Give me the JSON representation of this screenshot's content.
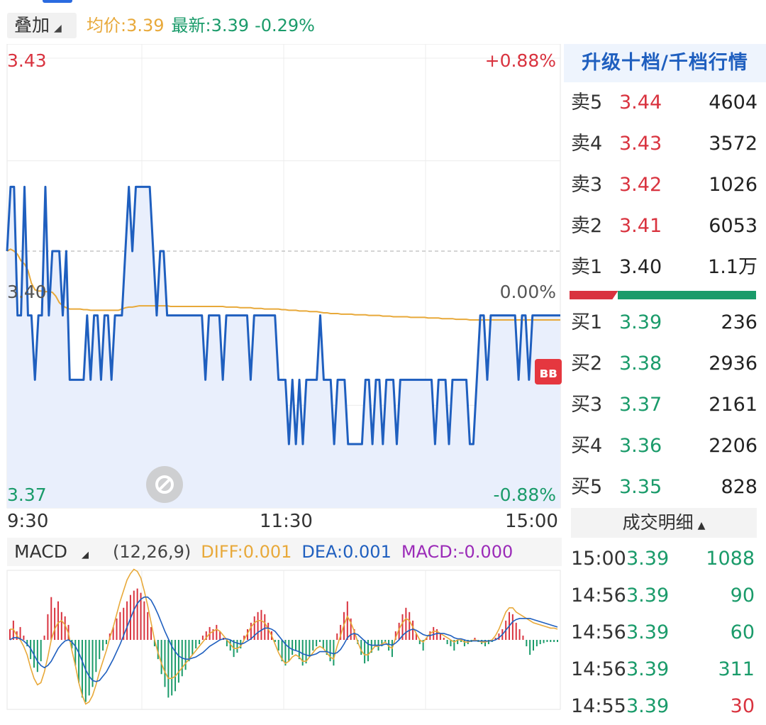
{
  "header": {
    "overlay_label": "叠加",
    "avg_price": "均价:3.39",
    "latest_price": "最新:3.39",
    "change_pct": "-0.29%"
  },
  "chart_data": [
    {
      "type": "line",
      "name": "intraday",
      "price_high_label": "3.43",
      "price_mid_label": "3.40",
      "price_low_label": "3.37",
      "pct_high_label": "+0.88%",
      "pct_mid_label": "0.00%",
      "pct_low_label": "-0.88%",
      "x_ticks": [
        "9:30",
        "11:30",
        "15:00"
      ],
      "ylim": [
        3.37,
        3.43
      ],
      "prev_close": 3.4,
      "price": [
        3.4,
        3.41,
        3.41,
        3.39,
        3.39,
        3.41,
        3.39,
        3.39,
        3.38,
        3.39,
        3.39,
        3.41,
        3.39,
        3.4,
        3.4,
        3.4,
        3.39,
        3.4,
        3.38,
        3.38,
        3.38,
        3.38,
        3.38,
        3.39,
        3.38,
        3.39,
        3.39,
        3.38,
        3.39,
        3.39,
        3.38,
        3.39,
        3.39,
        3.39,
        3.4,
        3.41,
        3.4,
        3.41,
        3.41,
        3.41,
        3.41,
        3.41,
        3.4,
        3.39,
        3.4,
        3.4,
        3.39,
        3.39,
        3.39,
        3.39,
        3.39,
        3.39,
        3.39,
        3.39,
        3.39,
        3.39,
        3.39,
        3.38,
        3.39,
        3.39,
        3.39,
        3.39,
        3.38,
        3.39,
        3.39,
        3.39,
        3.39,
        3.39,
        3.39,
        3.39,
        3.38,
        3.39,
        3.39,
        3.39,
        3.39,
        3.39,
        3.39,
        3.39,
        3.38,
        3.38,
        3.38,
        3.37,
        3.38,
        3.37,
        3.38,
        3.37,
        3.38,
        3.38,
        3.38,
        3.38,
        3.39,
        3.38,
        3.38,
        3.38,
        3.37,
        3.38,
        3.38,
        3.38,
        3.37,
        3.37,
        3.37,
        3.37,
        3.37,
        3.38,
        3.38,
        3.37,
        3.38,
        3.38,
        3.37,
        3.38,
        3.38,
        3.38,
        3.37,
        3.38,
        3.38,
        3.38,
        3.38,
        3.38,
        3.38,
        3.38,
        3.38,
        3.38,
        3.38,
        3.37,
        3.38,
        3.38,
        3.38,
        3.37,
        3.38,
        3.38,
        3.38,
        3.38,
        3.38,
        3.37,
        3.37,
        3.38,
        3.39,
        3.39,
        3.38,
        3.39,
        3.39,
        3.39,
        3.39,
        3.39,
        3.39,
        3.39,
        3.39,
        3.38,
        3.39,
        3.39,
        3.38,
        3.39,
        3.39,
        3.39,
        3.39,
        3.39,
        3.39,
        3.39,
        3.39,
        3.39
      ],
      "avg_price": [
        3.4,
        3.4003,
        3.4,
        3.3995,
        3.3985,
        3.398,
        3.397,
        3.395,
        3.394,
        3.3938,
        3.3938,
        3.3937,
        3.3937,
        3.3936,
        3.393,
        3.392,
        3.3915,
        3.3912,
        3.391,
        3.391,
        3.391,
        3.391,
        3.3909,
        3.3909,
        3.3908,
        3.3908,
        3.3908,
        3.3908,
        3.3908,
        3.3908,
        3.3908,
        3.3908,
        3.3908,
        3.391,
        3.3912,
        3.3913,
        3.3913,
        3.3914,
        3.3915,
        3.3915,
        3.3915,
        3.3915,
        3.3915,
        3.3915,
        3.3915,
        3.3915,
        3.3915,
        3.3914,
        3.3914,
        3.3914,
        3.3914,
        3.3914,
        3.3914,
        3.3914,
        3.3914,
        3.3914,
        3.3914,
        3.3914,
        3.3914,
        3.3914,
        3.3914,
        3.3914,
        3.3914,
        3.3913,
        3.3913,
        3.3913,
        3.3913,
        3.3912,
        3.3912,
        3.3912,
        3.3912,
        3.3911,
        3.3911,
        3.3911,
        3.391,
        3.391,
        3.391,
        3.391,
        3.391,
        3.3909,
        3.3909,
        3.3908,
        3.3908,
        3.3908,
        3.3907,
        3.3907,
        3.3907,
        3.3906,
        3.3906,
        3.3906,
        3.3905,
        3.3904,
        3.3904,
        3.3903,
        3.3903,
        3.3903,
        3.3902,
        3.3902,
        3.3902,
        3.3902,
        3.3901,
        3.3901,
        3.3901,
        3.3901,
        3.39,
        3.39,
        3.39,
        3.39,
        3.3899,
        3.3899,
        3.3899,
        3.3898,
        3.3898,
        3.3898,
        3.3898,
        3.3898,
        3.3897,
        3.3897,
        3.3897,
        3.3897,
        3.3897,
        3.3896,
        3.3896,
        3.3896,
        3.3896,
        3.3895,
        3.3895,
        3.3895,
        3.3895,
        3.3894,
        3.3894,
        3.3894,
        3.3894,
        3.3893,
        3.3893,
        3.3893,
        3.3893,
        3.3893,
        3.3893,
        3.3893,
        3.3893,
        3.3893,
        3.3893,
        3.3893,
        3.3893,
        3.3893,
        3.3893,
        3.3893,
        3.3893,
        3.3893,
        3.3893,
        3.3893,
        3.3893,
        3.3893,
        3.3893,
        3.3893,
        3.3893,
        3.3893,
        3.3893,
        3.3893
      ]
    },
    {
      "type": "bar",
      "name": "MACD",
      "label": "MACD",
      "params": "(12,26,9)",
      "diff_label": "DIFF:0.001",
      "dea_label": "DEA:0.001",
      "macd_label": "MACD:-0.000",
      "ylim": [
        -0.0065,
        0.0065
      ],
      "macd": [
        0.001,
        0.0018,
        0.0008,
        0.0012,
        0.0004,
        -0.0006,
        -0.0018,
        -0.0026,
        -0.003,
        -0.002,
        0.0004,
        0.0024,
        0.004,
        0.003,
        0.0036,
        0.0026,
        0.0022,
        0.0014,
        -0.0008,
        -0.0024,
        -0.004,
        -0.0054,
        -0.0058,
        -0.0052,
        -0.0044,
        -0.003,
        -0.0018,
        -0.001,
        -0.0004,
        0.0006,
        0.0012,
        0.002,
        0.0026,
        0.003,
        0.0036,
        0.0042,
        0.0046,
        0.0048,
        0.0044,
        0.0036,
        0.0026,
        0.0012,
        -0.0006,
        -0.0018,
        -0.0032,
        -0.0044,
        -0.0054,
        -0.0052,
        -0.0048,
        -0.004,
        -0.0034,
        -0.0028,
        -0.002,
        -0.0014,
        -0.0008,
        -0.0004,
        0.0004,
        0.0008,
        0.0012,
        0.001,
        0.0014,
        0.0008,
        0.0002,
        -0.0006,
        -0.001,
        -0.0016,
        -0.0012,
        -0.0008,
        0.0004,
        0.001,
        0.0016,
        0.0022,
        0.0026,
        0.0028,
        0.0024,
        0.0016,
        0.0008,
        -0.0002,
        -0.001,
        -0.002,
        -0.0024,
        -0.002,
        -0.0014,
        -0.001,
        -0.0018,
        -0.0024,
        -0.0022,
        -0.0016,
        -0.001,
        -0.0006,
        -0.0002,
        -0.0008,
        -0.0014,
        -0.002,
        -0.0024,
        0.0006,
        0.0014,
        0.0026,
        0.0036,
        0.002,
        0.001,
        -0.0004,
        -0.0014,
        -0.0022,
        -0.002,
        -0.0012,
        -0.0006,
        -0.001,
        -0.0006,
        -0.0002,
        -0.001,
        -0.0016,
        0.0008,
        0.0016,
        0.0024,
        0.003,
        0.0026,
        0.0018,
        0.0006,
        -0.0004,
        -0.001,
        0.0002,
        0.0008,
        0.0012,
        0.001,
        0.0006,
        0.0002,
        -0.0004,
        -0.0006,
        -0.001,
        -0.0004,
        -0.0002,
        -0.0006,
        -0.0004,
        -0.0002,
        0.0002,
        -0.0002,
        -0.0004,
        -0.0006,
        -0.0004,
        -0.0002,
        0.0002,
        0.0006,
        0.001,
        0.0018,
        0.0026,
        0.0024,
        0.0016,
        0.001,
        0.0004,
        -0.0006,
        -0.0014,
        -0.001,
        -0.0006,
        -0.0004,
        -0.0003,
        -0.0002,
        -0.0002,
        -0.0002,
        -0.0002
      ],
      "diff": [
        0.001,
        0.001,
        0.0004,
        0.0,
        -0.0006,
        -0.0014,
        -0.0026,
        -0.0036,
        -0.0042,
        -0.004,
        -0.003,
        -0.0016,
        0.0,
        0.001,
        0.0016,
        0.0018,
        0.0014,
        0.0006,
        -0.001,
        -0.0024,
        -0.004,
        -0.0052,
        -0.006,
        -0.0058,
        -0.0052,
        -0.0042,
        -0.003,
        -0.002,
        -0.001,
        0.0002,
        0.0012,
        0.0024,
        0.0036,
        0.0046,
        0.0056,
        0.0062,
        0.0066,
        0.0064,
        0.0058,
        0.0046,
        0.0032,
        0.0016,
        0.0,
        -0.0012,
        -0.0022,
        -0.003,
        -0.0036,
        -0.0036,
        -0.0034,
        -0.003,
        -0.0026,
        -0.0022,
        -0.0018,
        -0.0014,
        -0.001,
        -0.0006,
        -0.0002,
        0.0002,
        0.0006,
        0.0008,
        0.001,
        0.0008,
        0.0004,
        0.0,
        -0.0004,
        -0.0008,
        -0.0008,
        -0.0006,
        0.0,
        0.0006,
        0.0012,
        0.0016,
        0.0018,
        0.0018,
        0.0016,
        0.001,
        0.0004,
        -0.0004,
        -0.0012,
        -0.0018,
        -0.0022,
        -0.002,
        -0.0016,
        -0.0014,
        -0.0016,
        -0.002,
        -0.002,
        -0.0016,
        -0.0012,
        -0.0008,
        -0.0006,
        -0.0008,
        -0.0012,
        -0.0016,
        -0.0018,
        -0.0006,
        0.0004,
        0.0014,
        0.0022,
        0.0016,
        0.0008,
        -0.0002,
        -0.001,
        -0.0014,
        -0.0014,
        -0.001,
        -0.0006,
        -0.0006,
        -0.0004,
        -0.0002,
        -0.0006,
        -0.0008,
        0.0002,
        0.001,
        0.0016,
        0.002,
        0.0018,
        0.0012,
        0.0006,
        0.0,
        -0.0002,
        0.0002,
        0.0006,
        0.0008,
        0.0008,
        0.0006,
        0.0004,
        0.0002,
        0.0,
        -0.0002,
        0.0,
        0.0,
        -0.0002,
        -0.0002,
        -0.0001,
        0.0,
        -0.0001,
        -0.0002,
        -0.0002,
        -0.0001,
        0.0,
        0.0004,
        0.001,
        0.0018,
        0.0026,
        0.003,
        0.003,
        0.0026,
        0.0024,
        0.0022,
        0.002,
        0.0018,
        0.0016,
        0.0015,
        0.0014,
        0.0013,
        0.0012,
        0.0011,
        0.0011,
        0.001
      ],
      "dea": [
        0.0,
        0.0002,
        0.0002,
        0.0001,
        -0.0001,
        -0.0004,
        -0.0008,
        -0.0014,
        -0.002,
        -0.0024,
        -0.0026,
        -0.0024,
        -0.002,
        -0.0014,
        -0.0008,
        -0.0004,
        -0.0001,
        0.0,
        -0.0002,
        -0.0006,
        -0.0012,
        -0.002,
        -0.0028,
        -0.0034,
        -0.0038,
        -0.0039,
        -0.0038,
        -0.0034,
        -0.003,
        -0.0024,
        -0.0018,
        -0.0011,
        -0.0004,
        0.0004,
        0.0012,
        0.002,
        0.0028,
        0.0034,
        0.0038,
        0.004,
        0.004,
        0.0037,
        0.0031,
        0.0024,
        0.0016,
        0.0008,
        0.0001,
        -0.0006,
        -0.0011,
        -0.0015,
        -0.0017,
        -0.0018,
        -0.0018,
        -0.0017,
        -0.0016,
        -0.0014,
        -0.0012,
        -0.0009,
        -0.0006,
        -0.0004,
        -0.0002,
        0.0,
        0.0001,
        0.0001,
        0.0,
        -0.0002,
        -0.0003,
        -0.0004,
        -0.0003,
        -0.0001,
        0.0001,
        0.0004,
        0.0007,
        0.0009,
        0.0011,
        0.0011,
        0.001,
        0.0008,
        0.0004,
        0.0,
        -0.0004,
        -0.0007,
        -0.0009,
        -0.001,
        -0.0011,
        -0.0013,
        -0.0014,
        -0.0015,
        -0.0014,
        -0.0013,
        -0.0011,
        -0.0011,
        -0.0011,
        -0.0012,
        -0.0013,
        -0.0012,
        -0.0009,
        -0.0004,
        0.0002,
        0.0005,
        0.0006,
        0.0005,
        0.0002,
        -0.0001,
        -0.0004,
        -0.0005,
        -0.0005,
        -0.0005,
        -0.0005,
        -0.0004,
        -0.0004,
        -0.0005,
        -0.0003,
        0.0,
        0.0004,
        0.0007,
        0.0009,
        0.001,
        0.0009,
        0.0007,
        0.0005,
        0.0004,
        0.0004,
        0.0005,
        0.0006,
        0.0006,
        0.0006,
        0.0005,
        0.0004,
        0.0002,
        0.0001,
        0.0001,
        0.0,
        -0.0001,
        -0.0001,
        -0.0001,
        -0.0001,
        -0.0001,
        -0.0001,
        -0.0001,
        -0.0001,
        0.0,
        0.0002,
        0.0005,
        0.0009,
        0.0013,
        0.0017,
        0.0019,
        0.002,
        0.002,
        0.002,
        0.002,
        0.0019,
        0.0018,
        0.0017,
        0.0016,
        0.0015,
        0.0014,
        0.0013,
        0.0012
      ]
    }
  ],
  "levels_panel": {
    "upgrade_label": "升级十档/千档行情",
    "asks": [
      {
        "label": "卖5",
        "price": "3.44",
        "volume": "4604"
      },
      {
        "label": "卖4",
        "price": "3.43",
        "volume": "3572"
      },
      {
        "label": "卖3",
        "price": "3.42",
        "volume": "1026"
      },
      {
        "label": "卖2",
        "price": "3.41",
        "volume": "6053"
      },
      {
        "label": "卖1",
        "price": "3.40",
        "volume": "1.1万"
      }
    ],
    "bids": [
      {
        "label": "买1",
        "price": "3.39",
        "volume": "236"
      },
      {
        "label": "买2",
        "price": "3.38",
        "volume": "2936"
      },
      {
        "label": "买3",
        "price": "3.37",
        "volume": "2161"
      },
      {
        "label": "买4",
        "price": "3.36",
        "volume": "2206"
      },
      {
        "label": "买5",
        "price": "3.35",
        "volume": "828"
      }
    ],
    "buy_ratio": 0.26
  },
  "trades": {
    "header_label": "成交明细",
    "rows": [
      {
        "time": "15:00",
        "price": "3.39",
        "volume": "1088"
      },
      {
        "time": "14:56",
        "price": "3.39",
        "volume": "90"
      },
      {
        "time": "14:56",
        "price": "3.39",
        "volume": "60"
      },
      {
        "time": "14:56",
        "price": "3.39",
        "volume": "311"
      },
      {
        "time": "14:55",
        "price": "3.39",
        "volume": "30"
      }
    ]
  },
  "colors": {
    "up": "#d9333f",
    "down": "#1a9b6a",
    "price_line": "#1f5fbf",
    "avg_line": "#e8a93a",
    "macd_purple": "#9b2bb8"
  }
}
